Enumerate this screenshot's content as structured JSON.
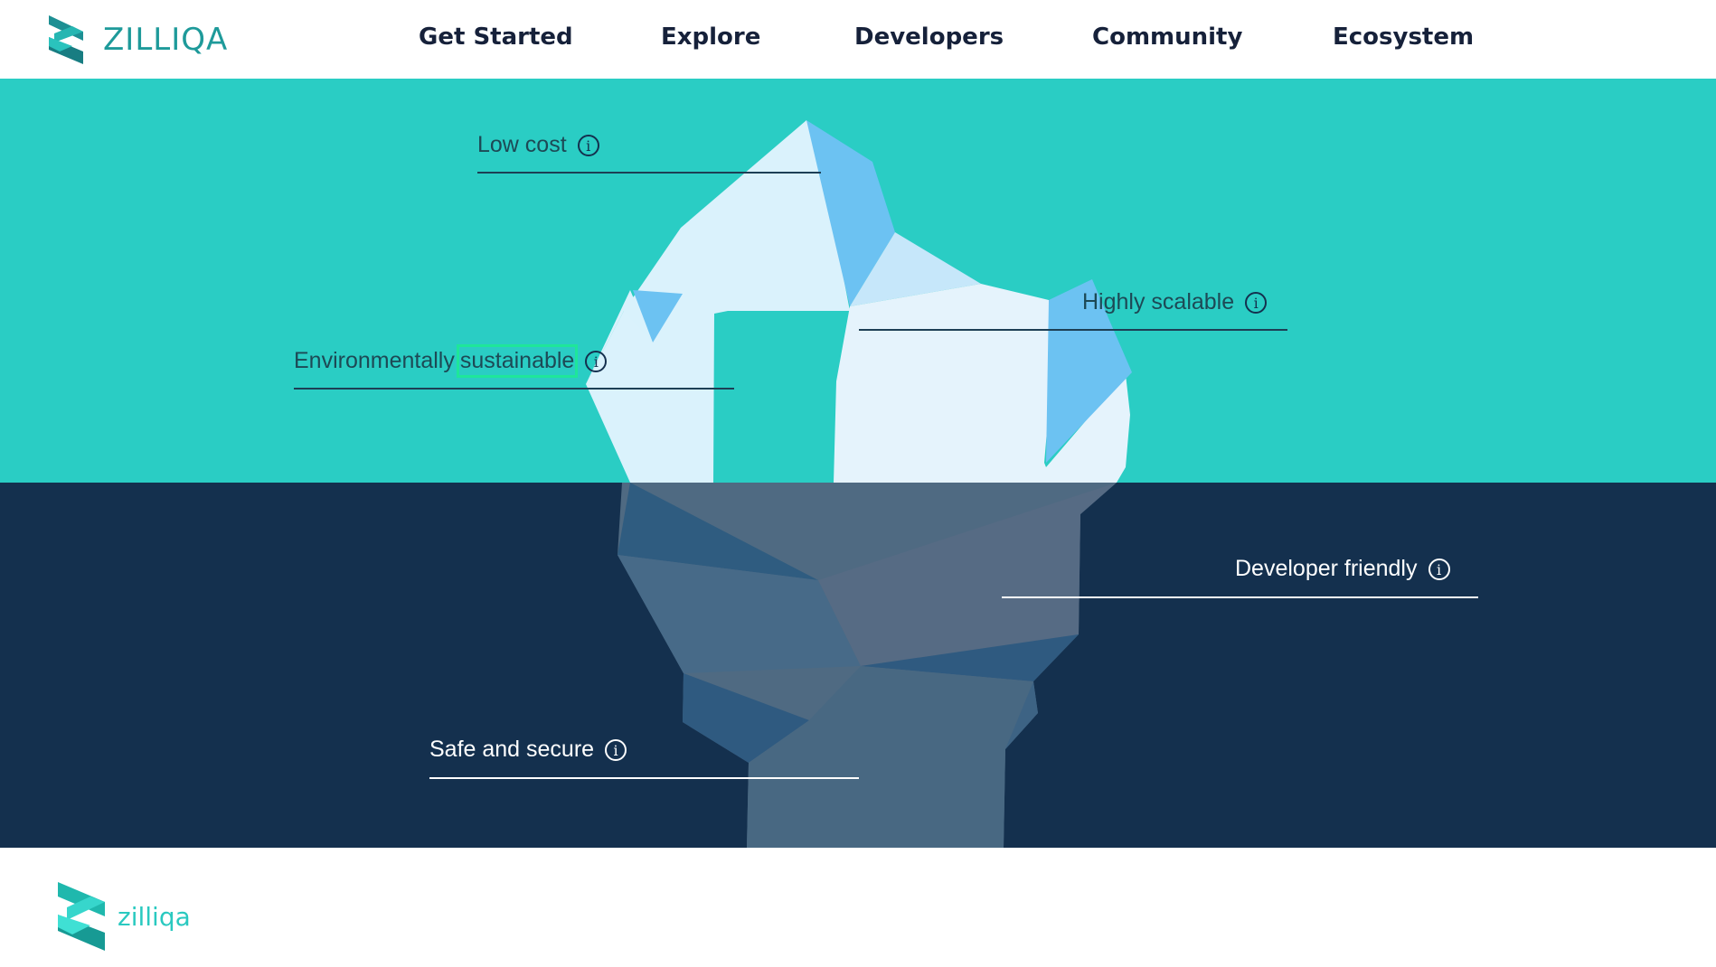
{
  "header": {
    "logo_text": "ZILLIQA",
    "nav": [
      "Get Started",
      "Explore",
      "Developers",
      "Community",
      "Ecosystem"
    ]
  },
  "features": {
    "low_cost": "Low cost",
    "env_prefix": "Environmentally",
    "env_highlight": "sustainable",
    "highly_scalable": "Highly scalable",
    "developer_friendly": "Developer friendly",
    "safe_secure": "Safe and secure",
    "info_glyph": "i"
  },
  "footer": {
    "logo_text": "zilliqa"
  },
  "colors": {
    "sky": "#2acdc4",
    "sea": "#14304e",
    "brand_teal": "#1e9a9a",
    "highlight_green": "#1ee69a"
  },
  "icons": [
    "zilliqa-logo-icon",
    "info-icon",
    "iceberg-illustration"
  ]
}
